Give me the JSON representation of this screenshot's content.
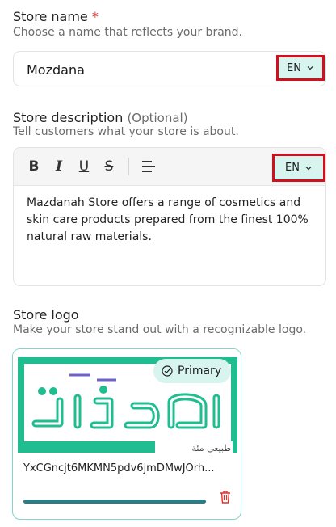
{
  "store_name": {
    "label": "Store name",
    "required_mark": "*",
    "help": "Choose a name that reflects your brand.",
    "value": "Mozdana",
    "lang": "EN"
  },
  "store_description": {
    "label": "Store description",
    "optional": "(Optional)",
    "help": "Tell customers what your store is about.",
    "lang": "EN",
    "toolbar": {
      "bold": "B",
      "italic": "I",
      "underline": "U",
      "strike": "S"
    },
    "text": "Mazdanah Store offers a range of cosmetics and skin care products prepared from the finest 100% natural raw materials."
  },
  "store_logo": {
    "label": "Store logo",
    "help": "Make your store stand out with a recognizable logo.",
    "badge": "Primary",
    "logo_text": "مزدانة",
    "logo_tagline": "طبيعي مئة",
    "filename": "YxCGncjt6MKMN5pdv6jmDMwJOrh...",
    "upload_progress": 1.0
  },
  "colors": {
    "accent": "#1fbd8f",
    "accent_light": "#d7f4ee",
    "highlight": "#d0101c",
    "progress": "#2e7d86",
    "danger": "#e0312b"
  }
}
